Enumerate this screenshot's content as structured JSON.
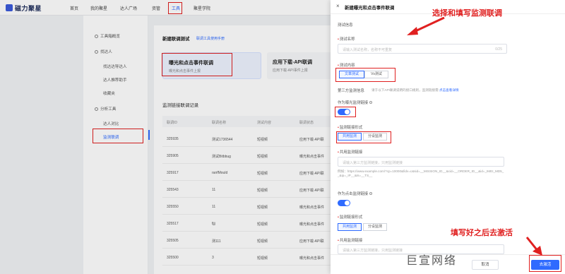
{
  "topnav": {
    "brand": "磁力聚星",
    "items": [
      "首页",
      "我的聚星",
      "达人广场",
      "资管",
      "工具",
      "聚星学院"
    ]
  },
  "sidebar": {
    "items": [
      "工具箱概览",
      "找达人",
      "找达达导达人",
      "达人推荐助手",
      "收藏夹",
      "分析工具",
      "达人对比",
      "监测联调"
    ]
  },
  "main": {
    "title": "新建联调测试",
    "subtitle": "联调工具使用手册",
    "cards": [
      {
        "title": "曝光和点击事件联调",
        "desc": "曝光和点击事件上报"
      },
      {
        "title": "应用下载-API联调",
        "desc": "应用下载-API事件上报"
      }
    ],
    "section_title": "监测链接联调记录",
    "table": {
      "headers": [
        "联调ID",
        "联调名称",
        "测试内容",
        "联调状态"
      ],
      "rows": [
        [
          "325935",
          "测试1736544",
          "短视频",
          "应用下载-API联"
        ],
        [
          "325905",
          "测试Bitbbug",
          "短视频",
          "曝光和点击事件"
        ],
        [
          "325917",
          "ranfMould",
          "短视频",
          "应用下载-API联"
        ],
        [
          "325543",
          "11",
          "短视频",
          "应用下载-API联"
        ],
        [
          "325550",
          "11",
          "短视频",
          "曝光和点击事件"
        ],
        [
          "325517",
          "fjjj",
          "短视频",
          "曝光和点击事件"
        ],
        [
          "325505",
          "测111",
          "短视频",
          "应用下载-API联"
        ],
        [
          "325500",
          "3",
          "短视频",
          "曝光和点击事件"
        ]
      ]
    }
  },
  "drawer": {
    "title": "新建曝光和点击事件联调",
    "close_label": "×",
    "section_label": "测试信息",
    "name_label": "测试名称",
    "name_placeholder": "请输入测试名称，名称不可重复",
    "name_counter": "0/25",
    "content_label": "测试内容",
    "content_options": [
      "文章测试",
      "Vs测试"
    ],
    "third_party_label": "第三方监测信息",
    "third_party_note": "请于以下API联调说明的接口规则，监测链接需",
    "third_party_link": "点击查看详情",
    "exposure_toggle_label": "作为曝光监测链接",
    "method_label": "监测链接形式",
    "method_options": [
      "共用监测",
      "分设监测"
    ],
    "shared_link_label": "共用监测链接",
    "shared_link_placeholder": "请输入第三方监测链接，只用监测链接",
    "example_text": "例如：https://www.example.com/?cp=10000&fidv=c&sid=__MISSION_ID__&cid=__ORDER_ID__&id=_IMEI_MD5__&ip=_IP__&ts=__TS__",
    "click_toggle_label": "作为点击监测链接",
    "method2_label": "监测链接形式",
    "method2_options": [
      "共用监测",
      "分设监测"
    ],
    "shared_link2_label": "共用监测链接",
    "shared_link2_placeholder": "请输入第三方监测链接，只用监测链接",
    "cancel_label": "取消",
    "confirm_label": "去激活"
  },
  "annotations": {
    "top": "选择和填写监测联调",
    "bottom": "填写好之后去激活"
  },
  "watermark": "巨宣网络",
  "colors": {
    "accent": "#2f6bff",
    "annotation": "#e02020"
  }
}
